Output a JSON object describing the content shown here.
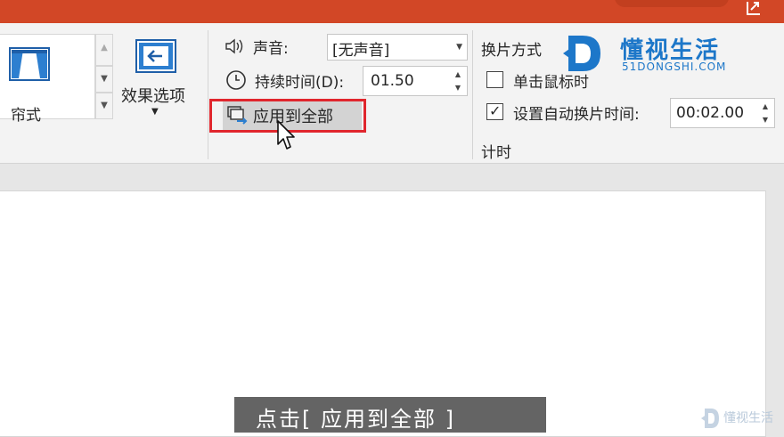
{
  "ribbon": {
    "gallery": {
      "selected_label": "帘式"
    },
    "effect_options": {
      "label": "效果选项"
    },
    "timing": {
      "sound_label": "声音:",
      "sound_value": "[无声音]",
      "duration_label": "持续时间(D):",
      "duration_value": "01.50",
      "apply_all_label": "应用到全部"
    },
    "advance": {
      "title": "换片方式",
      "on_click_label": "单击鼠标时",
      "on_click_checked": false,
      "after_label": "设置自动换片时间:",
      "after_checked": true,
      "after_value": "00:02.00",
      "group_label": "计时"
    }
  },
  "watermark": {
    "name": "懂视生活",
    "url": "51DONGSHI.COM",
    "brand_color": "#1d77c9"
  },
  "subtitle": "点击[ 应用到全部 ]",
  "corner_watermark": "懂视生活",
  "colors": {
    "title_bar": "#d24726",
    "highlight_box": "#e0262d",
    "ribbon_bg": "#f3f3f3"
  }
}
